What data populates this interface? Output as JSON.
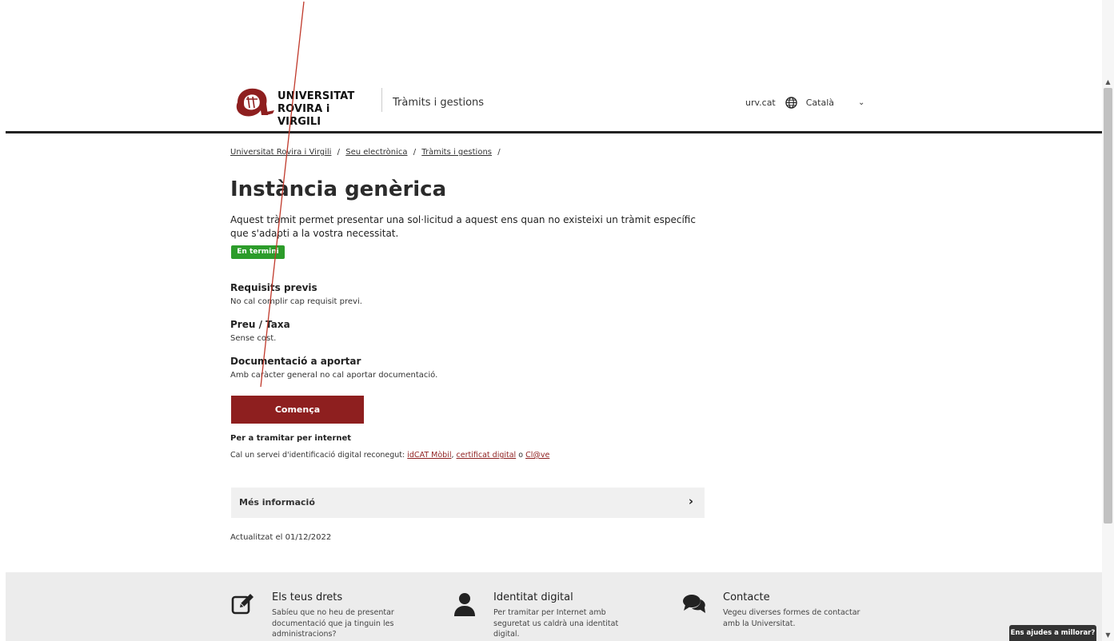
{
  "header": {
    "logo_line1": "UNIVERSITAT",
    "logo_line2": "ROVIRA i VIRGILI",
    "section": "Tràmits i gestions",
    "site_link": "urv.cat",
    "language": "Català"
  },
  "breadcrumb": {
    "items": [
      "Universitat Rovira i Virgili",
      "Seu electrònica",
      "Tràmits i gestions"
    ],
    "separator": "/"
  },
  "main": {
    "title": "Instància genèrica",
    "intro": "Aquest tràmit permet presentar una sol·licitud a aquest ens quan no existeixi un tràmit específic que s'adapti a la vostra necessitat.",
    "status_badge": "En termini",
    "sections": [
      {
        "title": "Requisits previs",
        "text": "No cal complir cap requisit previ."
      },
      {
        "title": "Preu / Taxa",
        "text": "Sense cost."
      },
      {
        "title": "Documentació a aportar",
        "text": "Amb caràcter general no cal aportar documentació."
      }
    ],
    "start_button": "Comença",
    "internet_title": "Per a tramitar per internet",
    "internet_text": "Cal un servei d'identificació digital reconegut:",
    "links": [
      "idCAT Mòbil",
      "certificat digital",
      "Cl@ve"
    ],
    "links_sep": ",",
    "links_or": "o",
    "more_info": "Més informació",
    "updated": "Actualitzat el 01/12/2022"
  },
  "footer": {
    "columns": [
      {
        "icon": "edit-icon",
        "title": "Els teus drets",
        "text": "Sabíeu que no heu de presentar documentació que ja tinguin les administracions?"
      },
      {
        "icon": "user-icon",
        "title": "Identitat digital",
        "text": "Per tramitar per Internet amb seguretat us caldrà una identitat digital."
      },
      {
        "icon": "chat-icon",
        "title": "Contacte",
        "text": "Vegeu diverses formes de contactar amb la Universitat."
      }
    ]
  },
  "feedback_button": "Ens ajudes a millorar?",
  "colors": {
    "brand": "#8e1f1f",
    "badge": "#2c9c2a",
    "footer_bg": "#ececec"
  }
}
